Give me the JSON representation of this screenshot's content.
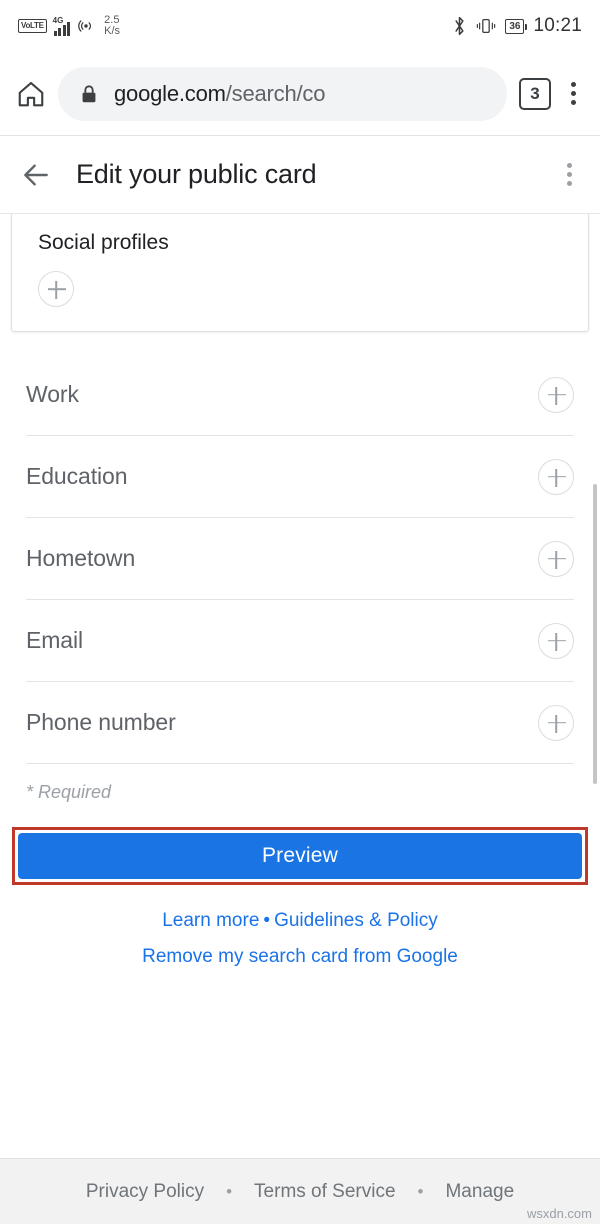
{
  "status_bar": {
    "volte_label": "VoLTE",
    "network_gen": "4G",
    "data_rate_value": "2.5",
    "data_rate_unit": "K/s",
    "hotspot_icon": "hotspot-icon",
    "bluetooth_icon": "bluetooth-icon",
    "vibrate_icon": "vibrate-icon",
    "battery_level": "36",
    "time": "10:21"
  },
  "browser": {
    "home_icon": "home-icon",
    "lock_icon": "lock-icon",
    "url_primary": "google.com",
    "url_secondary": "/search/co",
    "tab_count": "3",
    "menu_icon": "overflow-menu-icon"
  },
  "page_header": {
    "back_icon": "back-arrow-icon",
    "title": "Edit your public card",
    "menu_icon": "overflow-menu-icon"
  },
  "social_card": {
    "title": "Social profiles",
    "add_icon": "plus-icon"
  },
  "fields": [
    {
      "label": "Work",
      "add_icon": "plus-icon"
    },
    {
      "label": "Education",
      "add_icon": "plus-icon"
    },
    {
      "label": "Hometown",
      "add_icon": "plus-icon"
    },
    {
      "label": "Email",
      "add_icon": "plus-icon"
    },
    {
      "label": "Phone number",
      "add_icon": "plus-icon"
    }
  ],
  "required_note": "* Required",
  "preview": {
    "button_label": "Preview",
    "highlight_color": "#c0392b",
    "button_color": "#1b74e4"
  },
  "links": {
    "learn_more": "Learn more",
    "separator": "•",
    "guidelines": "Guidelines & Policy",
    "remove_card": "Remove my search card from Google",
    "link_color": "#1a73e8"
  },
  "footer": {
    "privacy": "Privacy Policy",
    "separator": "•",
    "terms": "Terms of Service",
    "manage": "Manage"
  },
  "watermark": "wsxdn.com"
}
